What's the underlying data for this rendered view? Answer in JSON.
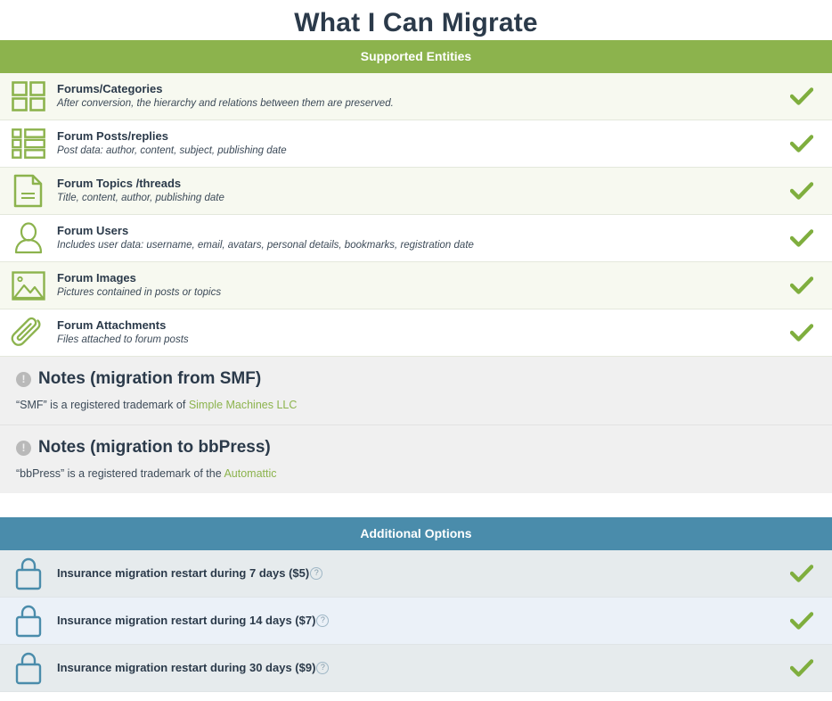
{
  "page": {
    "title": "What I Can Migrate"
  },
  "colors": {
    "green_header": "#8cb34d",
    "blue_header": "#4a8cab",
    "check_green": "#7fae3e",
    "lock_blue": "#4a8cab",
    "link_green": "#8cb34d",
    "row_green_light": "#f7f9f0",
    "row_white": "#ffffff",
    "row_blue_a": "#e6ebed",
    "row_blue_b": "#ebf1f8",
    "notes_bg": "#f0f0f0",
    "title_text": "#2b3a4a"
  },
  "supported": {
    "header": "Supported Entities",
    "items": [
      {
        "icon": "grid-squares-icon",
        "title": "Forums/Categories",
        "subtitle": "After conversion, the hierarchy and relations between them are preserved.",
        "status": "check"
      },
      {
        "icon": "list-rows-icon",
        "title": "Forum Posts/replies",
        "subtitle": "Post data: author, content, subject, publishing date",
        "status": "check"
      },
      {
        "icon": "document-icon",
        "title": "Forum Topics /threads",
        "subtitle": "Title, content, author, publishing date",
        "status": "check"
      },
      {
        "icon": "user-icon",
        "title": "Forum Users",
        "subtitle": "Includes user data: username, email, avatars, personal details, bookmarks, registration date",
        "status": "check"
      },
      {
        "icon": "image-icon",
        "title": "Forum Images",
        "subtitle": "Pictures contained in posts or topics",
        "status": "check"
      },
      {
        "icon": "paperclip-icon",
        "title": "Forum Attachments",
        "subtitle": "Files attached to forum posts",
        "status": "check"
      }
    ]
  },
  "notes": [
    {
      "icon": "info-icon",
      "heading": "Notes (migration from SMF)",
      "body_prefix": "“SMF” is a registered trademark of ",
      "link": "Simple Machines LLC"
    },
    {
      "icon": "info-icon",
      "heading": "Notes (migration to bbPress)",
      "body_prefix": "“bbPress” is a registered trademark of the ",
      "link": "Automattic"
    }
  ],
  "additional": {
    "header": "Additional Options",
    "items": [
      {
        "icon": "lock-icon",
        "title": "Insurance migration restart during 7 days ($5)",
        "help": "?",
        "status": "check"
      },
      {
        "icon": "lock-icon",
        "title": "Insurance migration restart during 14 days ($7)",
        "help": "?",
        "status": "check"
      },
      {
        "icon": "lock-icon",
        "title": "Insurance migration restart during 30 days ($9)",
        "help": "?",
        "status": "check"
      }
    ]
  }
}
